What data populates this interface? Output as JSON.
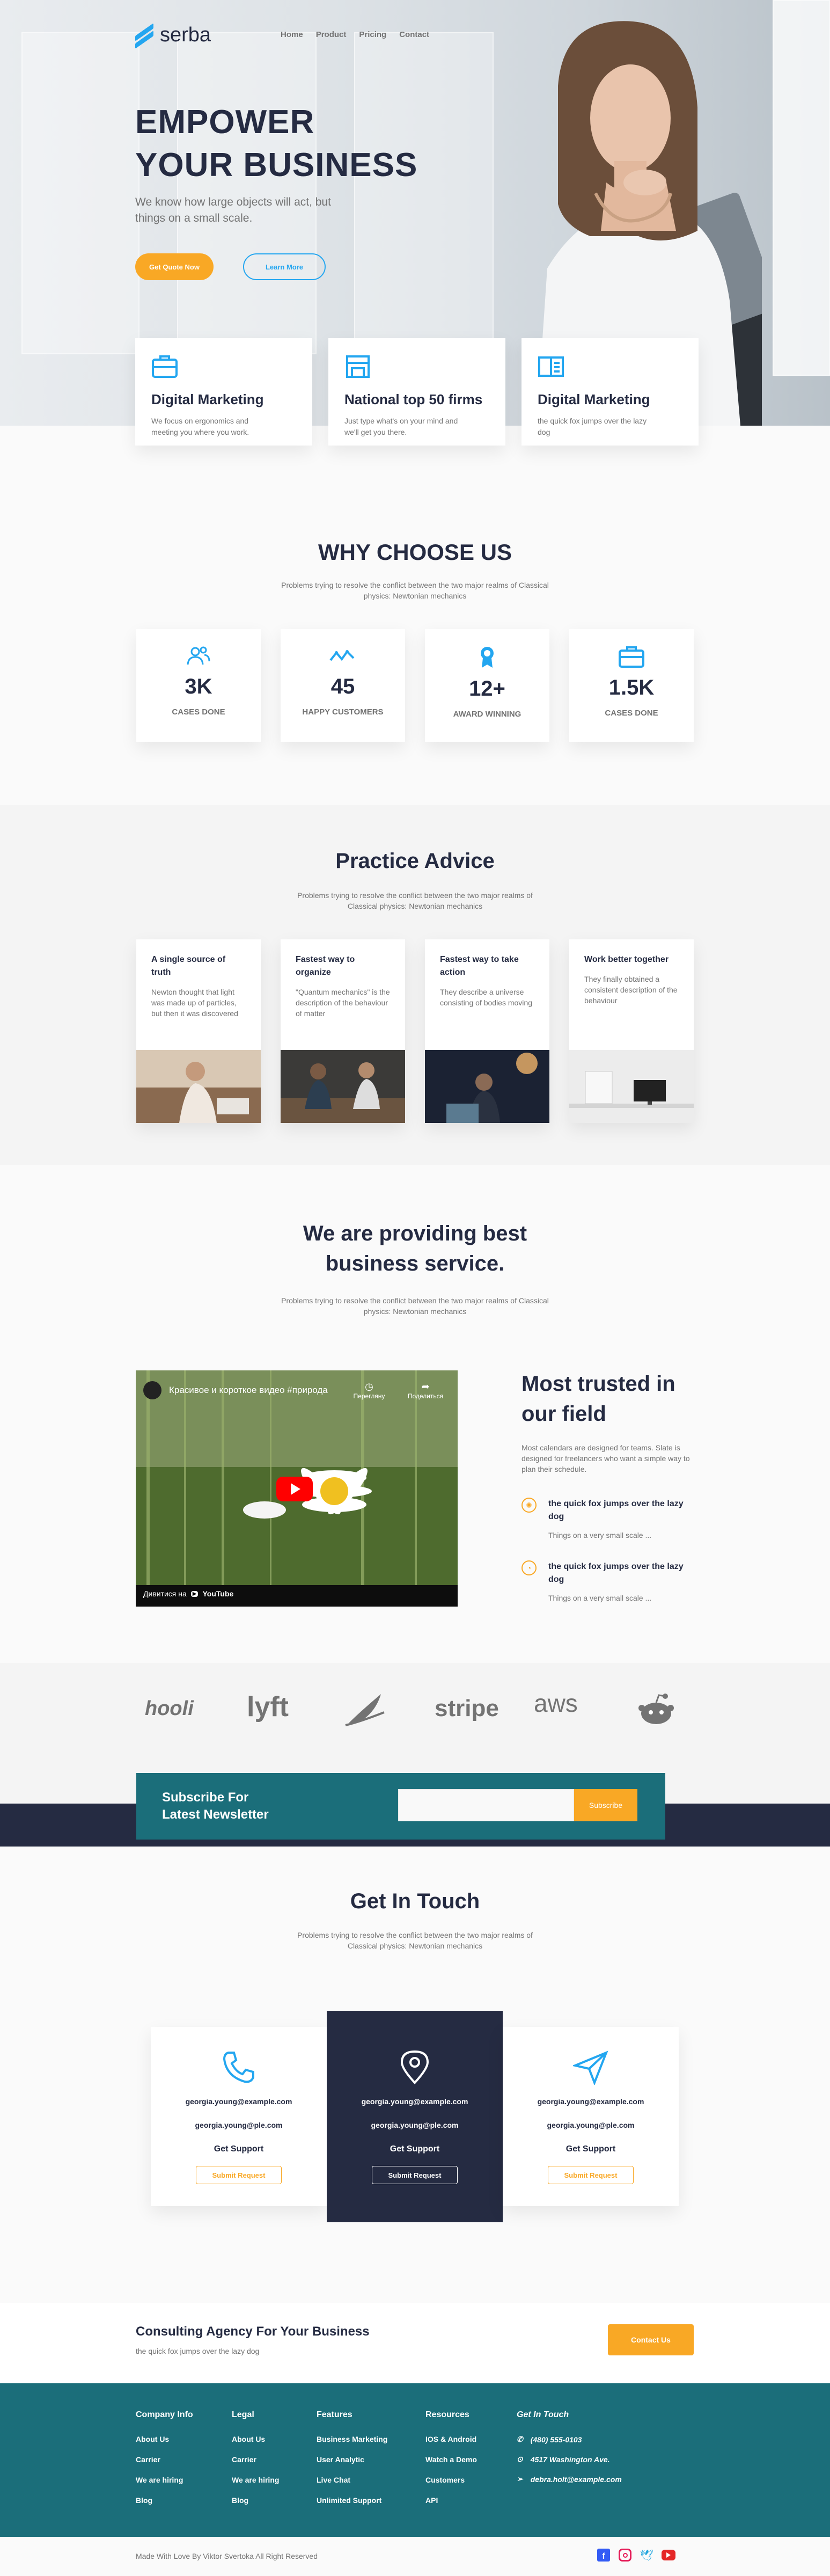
{
  "brand": "serba",
  "nav": [
    "Home",
    "Product",
    "Pricing",
    "Contact"
  ],
  "hero": {
    "title_line1": "EMPOWER",
    "title_line2": "YOUR BUSINESS",
    "subtitle": "We know how large objects will act, but things on a small scale.",
    "primary_btn": "Get Quote Now",
    "secondary_btn": "Learn More"
  },
  "features": [
    {
      "title": "Digital Marketing",
      "text": "We focus on ergonomics and meeting you where you work.",
      "icon": "briefcase-icon"
    },
    {
      "title": "National top 50 firms",
      "text": "Just type what's on your mind and we'll get you there.",
      "icon": "shop-icon"
    },
    {
      "title": "Digital Marketing",
      "text": "the quick fox jumps over the lazy dog",
      "icon": "book-icon"
    }
  ],
  "why": {
    "title": "WHY CHOOSE US",
    "text": "Problems trying to resolve the conflict between the two major realms of Classical physics: Newtonian mechanics",
    "stats": [
      {
        "n": "3K",
        "l": "CASES DONE",
        "icon": "users-icon"
      },
      {
        "n": "45",
        "l": "HAPPY CUSTOMERS",
        "icon": "trend-icon"
      },
      {
        "n": "12+",
        "l": "AWARD WINNING",
        "icon": "award-icon"
      },
      {
        "n": "1.5K",
        "l": "CASES DONE",
        "icon": "briefcase-icon"
      }
    ]
  },
  "practice": {
    "title": "Practice Advice",
    "text": "Problems trying to resolve the conflict between the two major realms of Classical physics: Newtonian mechanics",
    "items": [
      {
        "title": "A single source of truth",
        "text": "Newton thought that light was made up of particles, but then it was discovered"
      },
      {
        "title": "Fastest way to organize",
        "text": "\"Quantum mechanics\" is the description of the behaviour of matter"
      },
      {
        "title": "Fastest way to take action",
        "text": "They describe a universe consisting of bodies moving"
      },
      {
        "title": "Work better together",
        "text": "They finally obtained a consistent description of the behaviour"
      }
    ]
  },
  "service": {
    "title_line1": "We are providing best",
    "title_line2": "business service.",
    "text": "Problems trying to resolve the conflict between the two major realms of Classical physics: Newtonian mechanics"
  },
  "video": {
    "title": "Красивое и короткое видео #природа",
    "share": "Поделиться",
    "later": "Перегляну",
    "watch_on": "Дивитися на",
    "yt": "YouTube"
  },
  "trusted": {
    "title_line1": "Most trusted in",
    "title_line2": "our field",
    "text": "Most calendars are designed for teams. Slate is designed for freelancers who want a simple way to plan their schedule.",
    "points": [
      {
        "title": "the quick fox jumps over the lazy dog",
        "text": "Things on a very small scale ..."
      },
      {
        "title": "the quick fox jumps over the lazy dog",
        "text": "Things on a very small scale ..."
      }
    ]
  },
  "logos": [
    "hooli",
    "lyft",
    "stripe",
    "aws"
  ],
  "newsletter": {
    "title_line1": "Subscribe For",
    "title_line2": "Latest Newsletter",
    "button": "Subscribe",
    "placeholder": ""
  },
  "touch": {
    "title": "Get In Touch",
    "text": "Problems trying to resolve the conflict between the two major realms of Classical physics: Newtonian mechanics",
    "cards": [
      {
        "m1": "georgia.young@example.com",
        "m2": "georgia.young@ple.com",
        "s": "Get Support",
        "b": "Submit Request",
        "icon": "phone-icon"
      },
      {
        "m1": "georgia.young@example.com",
        "m2": "georgia.young@ple.com",
        "s": "Get Support",
        "b": "Submit Request",
        "icon": "location-icon"
      },
      {
        "m1": "georgia.young@example.com",
        "m2": "georgia.young@ple.com",
        "s": "Get Support",
        "b": "Submit Request",
        "icon": "send-icon"
      }
    ]
  },
  "cta": {
    "title": "Consulting Agency For Your Business",
    "text": "the quick fox jumps over the lazy dog",
    "button": "Contact Us"
  },
  "footer": {
    "cols": [
      {
        "h": "Company Info",
        "items": [
          "About Us",
          "Carrier",
          "We are hiring",
          "Blog"
        ]
      },
      {
        "h": "Legal",
        "items": [
          "About Us",
          "Carrier",
          "We are hiring",
          "Blog"
        ]
      },
      {
        "h": "Features",
        "items": [
          "Business Marketing",
          "User Analytic",
          "Live Chat",
          "Unlimited Support"
        ]
      },
      {
        "h": "Resources",
        "items": [
          "IOS & Android",
          "Watch a Demo",
          "Customers",
          "API"
        ]
      }
    ],
    "touch": {
      "h": "Get In Touch",
      "phone": "(480) 555-0103",
      "addr": "4517 Washington Ave.",
      "email": "debra.holt@example.com"
    },
    "copyright": "Made With Love By Viktor Svertoka All Right Reserved",
    "colors": {
      "accent": "#23a6f0",
      "orange": "#f9a825",
      "teal": "#1b6e7a",
      "navy": "#252b42"
    }
  }
}
